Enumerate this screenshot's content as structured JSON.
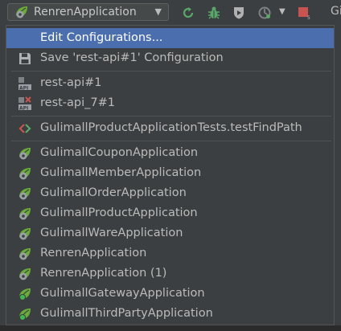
{
  "toolbar": {
    "run_config": "RenrenApplication",
    "trailing_text": "Gi",
    "icons": [
      "spring-boot-icon",
      "rerun-icon",
      "debug-icon",
      "coverage-icon",
      "profile-icon",
      "stop-icon"
    ]
  },
  "menu": {
    "edit_configurations": "Edit Configurations...",
    "save_configuration": "Save 'rest-api#1' Configuration",
    "api_items": [
      "rest-api#1",
      "rest-api_7#1"
    ],
    "test_item": "GulimallProductApplicationTests.testFindPath",
    "app_items": [
      "GulimallCouponApplication",
      "GulimallMemberApplication",
      "GulimallOrderApplication",
      "GulimallProductApplication",
      "GulimallWareApplication",
      "RenrenApplication",
      "RenrenApplication (1)",
      "GulimallGatewayApplication",
      "GulimallThirdPartyApplication"
    ]
  },
  "colors": {
    "background": "#3c3f41",
    "selection": "#4b6eaf",
    "text": "#bbbbbb",
    "spring_green": "#6aab3a",
    "stop_red": "#c75450"
  }
}
